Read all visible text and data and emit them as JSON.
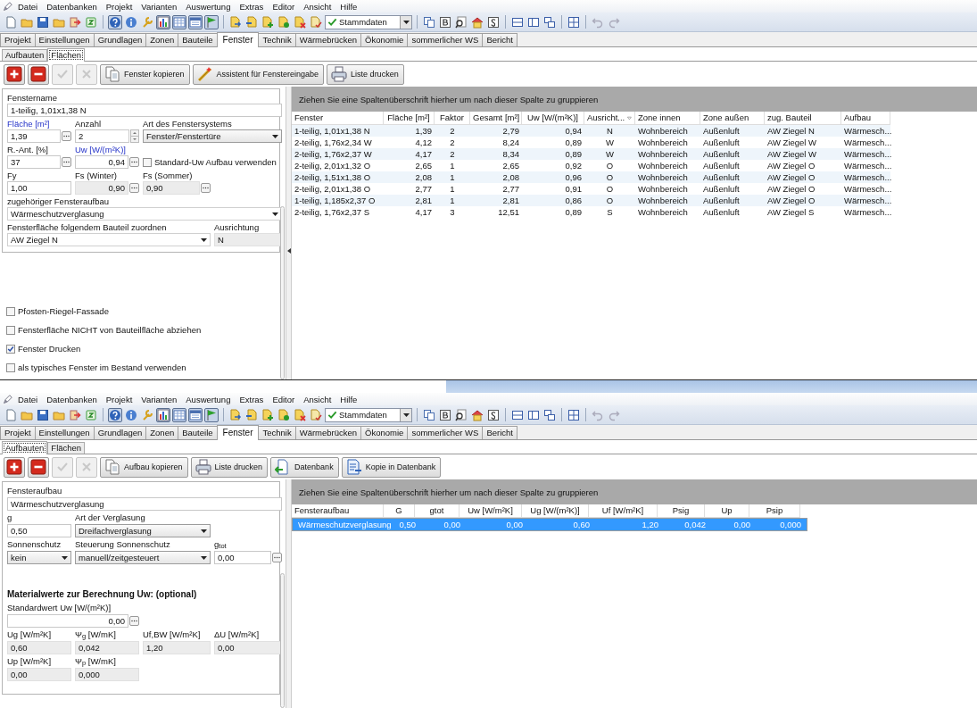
{
  "screens": [
    {
      "menu": [
        "Datei",
        "Datenbanken",
        "Projekt",
        "Varianten",
        "Auswertung",
        "Extras",
        "Editor",
        "Ansicht",
        "Hilfe"
      ],
      "dataset": "Stammdaten",
      "tabs": [
        {
          "label": "Projekt",
          "selected": false
        },
        {
          "label": "Einstellungen",
          "selected": false
        },
        {
          "label": "Grundlagen",
          "selected": false
        },
        {
          "label": "Zonen",
          "selected": false
        },
        {
          "label": "Bauteile",
          "selected": false
        },
        {
          "label": "Fenster",
          "selected": true
        },
        {
          "label": "Technik",
          "selected": false
        },
        {
          "label": "Wärmebrücken",
          "selected": false
        },
        {
          "label": "Ökonomie",
          "selected": false
        },
        {
          "label": "sommerlicher WS",
          "selected": false
        },
        {
          "label": "Bericht",
          "selected": false
        }
      ],
      "subtabs": [
        {
          "label": "Aufbauten",
          "selected": false
        },
        {
          "label": "Flächen",
          "selected": true
        }
      ],
      "actions": [
        {
          "kind": "add",
          "disabled": false
        },
        {
          "kind": "remove",
          "disabled": false
        },
        {
          "kind": "confirm",
          "disabled": true
        },
        {
          "kind": "cancel",
          "disabled": true
        },
        {
          "kind": "copy",
          "label": "Fenster kopieren",
          "disabled": false
        },
        {
          "kind": "wand",
          "label": "Assistent für Fenstereingabe",
          "disabled": false
        },
        {
          "kind": "print",
          "label": "Liste drucken",
          "disabled": false
        }
      ],
      "form": [
        [
          {
            "kind": "text_wide",
            "label": "Fenstername",
            "value": "1-teilig, 1,01x1,38 N",
            "link": false
          }
        ],
        [
          {
            "kind": "picker",
            "label": "Fläche [m²]",
            "value": "1,39",
            "link": true
          },
          {
            "kind": "spin",
            "label": "Anzahl",
            "value": "2",
            "link": false
          },
          {
            "kind": "select_wide",
            "label": "Art des Fenstersystems",
            "value": "Fenster/Fenstertüre",
            "link": false
          }
        ],
        [
          {
            "kind": "picker",
            "label": "R.-Ant. [%]",
            "value": "37",
            "link": false
          },
          {
            "kind": "picker_num",
            "label": "Uw [W/(m²K)]",
            "value": "0,94",
            "link": true
          },
          {
            "kind": "checkbox",
            "label": "Standard-Uw Aufbau verwenden",
            "checked": false
          }
        ],
        [
          {
            "kind": "text",
            "label": "Fy",
            "value": "1,00",
            "link": false
          },
          {
            "kind": "readonly_picker_num",
            "label": "Fs (Winter)",
            "value": "0,90",
            "link": false
          },
          {
            "kind": "readonly_picker",
            "label": "Fs (Sommer)",
            "value": "0,90",
            "link": false
          }
        ],
        [
          {
            "kind": "select_full",
            "label": "zugehöriger Fensteraufbau",
            "value": "Wärmeschutzverglasung",
            "link": false
          }
        ],
        [
          {
            "kind": "select_long",
            "label": "Fensterfläche folgendem Bauteil zuordnen",
            "value": "AW Ziegel N",
            "link": false
          },
          {
            "kind": "readonly",
            "label": "Ausrichtung",
            "value": "N",
            "link": false
          }
        ]
      ],
      "options": [
        {
          "label": "Pfosten-Riegel-Fassade",
          "checked": false
        },
        {
          "label": "Fensterfläche NICHT von Bauteilfläche abziehen",
          "checked": false
        },
        {
          "label": "Fenster Drucken",
          "checked": true
        },
        {
          "label": "als typisches Fenster im Bestand verwenden",
          "checked": false
        }
      ],
      "splitter_arrow": true,
      "grid": {
        "group_hint": "Ziehen Sie eine Spaltenüberschrift hierher um nach dieser Spalte zu gruppieren",
        "columns": [
          {
            "label": "Fenster",
            "kind": "text",
            "sorted": false
          },
          {
            "label": "Fläche [m²]",
            "kind": "number",
            "sorted": false
          },
          {
            "label": "Faktor",
            "kind": "center",
            "sorted": false
          },
          {
            "label": "Gesamt [m²]",
            "kind": "number",
            "sorted": false
          },
          {
            "label": "Uw [W/(m²K)]",
            "kind": "number",
            "sorted": false
          },
          {
            "label": "Ausricht...",
            "kind": "center",
            "sorted": true
          },
          {
            "label": "Zone innen",
            "kind": "text",
            "sorted": false
          },
          {
            "label": "Zone außen",
            "kind": "text",
            "sorted": false
          },
          {
            "label": "zug. Bauteil",
            "kind": "text",
            "sorted": false
          },
          {
            "label": "Aufbau",
            "kind": "text",
            "sorted": false
          }
        ],
        "rows": [
          {
            "selected": false,
            "cells": [
              "1-teilig, 1,01x1,38 N",
              "1,39",
              "2",
              "2,79",
              "0,94",
              "N",
              "Wohnbereich",
              "Außenluft",
              "AW Ziegel N",
              "Wärmesch..."
            ]
          },
          {
            "selected": false,
            "cells": [
              "2-teilig, 1,76x2,34 W",
              "4,12",
              "2",
              "8,24",
              "0,89",
              "W",
              "Wohnbereich",
              "Außenluft",
              "AW Ziegel W",
              "Wärmesch..."
            ]
          },
          {
            "selected": false,
            "cells": [
              "2-teilig, 1,76x2,37 W",
              "4,17",
              "2",
              "8,34",
              "0,89",
              "W",
              "Wohnbereich",
              "Außenluft",
              "AW Ziegel W",
              "Wärmesch..."
            ]
          },
          {
            "selected": false,
            "cells": [
              "2-teilig, 2,01x1,32 O",
              "2,65",
              "1",
              "2,65",
              "0,92",
              "O",
              "Wohnbereich",
              "Außenluft",
              "AW Ziegel O",
              "Wärmesch..."
            ]
          },
          {
            "selected": false,
            "cells": [
              "2-teilig, 1,51x1,38 O",
              "2,08",
              "1",
              "2,08",
              "0,96",
              "O",
              "Wohnbereich",
              "Außenluft",
              "AW Ziegel O",
              "Wärmesch..."
            ]
          },
          {
            "selected": false,
            "cells": [
              "2-teilig, 2,01x1,38 O",
              "2,77",
              "1",
              "2,77",
              "0,91",
              "O",
              "Wohnbereich",
              "Außenluft",
              "AW Ziegel O",
              "Wärmesch..."
            ]
          },
          {
            "selected": false,
            "cells": [
              "1-teilig, 1,185x2,37 O",
              "2,81",
              "1",
              "2,81",
              "0,86",
              "O",
              "Wohnbereich",
              "Außenluft",
              "AW Ziegel O",
              "Wärmesch..."
            ]
          },
          {
            "selected": false,
            "cells": [
              "2-teilig, 1,76x2,37 S",
              "4,17",
              "3",
              "12,51",
              "0,89",
              "S",
              "Wohnbereich",
              "Außenluft",
              "AW Ziegel S",
              "Wärmesch..."
            ]
          }
        ]
      }
    },
    {
      "menu": [
        "Datei",
        "Datenbanken",
        "Projekt",
        "Varianten",
        "Auswertung",
        "Extras",
        "Editor",
        "Ansicht",
        "Hilfe"
      ],
      "dataset": "Stammdaten",
      "tabs": [
        {
          "label": "Projekt",
          "selected": false
        },
        {
          "label": "Einstellungen",
          "selected": false
        },
        {
          "label": "Grundlagen",
          "selected": false
        },
        {
          "label": "Zonen",
          "selected": false
        },
        {
          "label": "Bauteile",
          "selected": false
        },
        {
          "label": "Fenster",
          "selected": true
        },
        {
          "label": "Technik",
          "selected": false
        },
        {
          "label": "Wärmebrücken",
          "selected": false
        },
        {
          "label": "Ökonomie",
          "selected": false
        },
        {
          "label": "sommerlicher WS",
          "selected": false
        },
        {
          "label": "Bericht",
          "selected": false
        }
      ],
      "subtabs": [
        {
          "label": "Aufbauten",
          "selected": true
        },
        {
          "label": "Flächen",
          "selected": false
        }
      ],
      "actions": [
        {
          "kind": "add",
          "disabled": false
        },
        {
          "kind": "remove",
          "disabled": false
        },
        {
          "kind": "confirm",
          "disabled": true
        },
        {
          "kind": "cancel",
          "disabled": true
        },
        {
          "kind": "copy",
          "label": "Aufbau kopieren",
          "disabled": false
        },
        {
          "kind": "print",
          "label": "Liste drucken",
          "disabled": false
        },
        {
          "kind": "database",
          "label": "Datenbank",
          "disabled": false
        },
        {
          "kind": "copy_db",
          "label": "Kopie in Datenbank",
          "disabled": false
        }
      ],
      "form": [
        [
          {
            "kind": "text_wide",
            "label": "Fensteraufbau",
            "value": "Wärmeschutzverglasung",
            "link": false
          }
        ],
        [
          {
            "kind": "text",
            "label": "g",
            "value": "0,50",
            "link": false
          },
          {
            "kind": "select_wide",
            "label": "Art der Verglasung",
            "value": "Dreifachverglasung",
            "link": false
          }
        ],
        [
          {
            "kind": "select",
            "label": "Sonnenschutz",
            "value": "kein",
            "link": false
          },
          {
            "kind": "select_wide",
            "label": "Steuerung Sonnenschutz",
            "value": "manuell/zeitgesteuert",
            "link": false
          },
          {
            "kind": "picker",
            "label": "g$_{tot}$",
            "value": "0,00",
            "link": false
          }
        ],
        [
          {
            "kind": "heading",
            "label": "Materialwerte zur Berechnung Uw: (optional)"
          }
        ],
        [
          {
            "kind": "picker_num_wide",
            "label": "Standardwert Uw [W/(m²K)]",
            "value": "0,00",
            "link": false
          }
        ],
        [
          {
            "kind": "readonly",
            "label": "Ug [W/m²K]",
            "value": "0,60",
            "link": false
          },
          {
            "kind": "readonly",
            "label": "Ψ$_{g}$ [W/mK]",
            "value": "0,042",
            "link": false
          },
          {
            "kind": "readonly",
            "label": "Uf,BW [W/m²K]",
            "value": "1,20",
            "link": false
          },
          {
            "kind": "readonly",
            "label": "ΔU [W/m²K]",
            "value": "0,00",
            "link": false
          }
        ],
        [
          {
            "kind": "readonly",
            "label": "Up [W/m²K]",
            "value": "0,00",
            "link": false
          },
          {
            "kind": "readonly",
            "label": "Ψ$_{p}$ [W/mK]",
            "value": "0,000",
            "link": false
          }
        ]
      ],
      "grid": {
        "group_hint": "Ziehen Sie eine Spaltenüberschrift hierher um nach dieser Spalte zu gruppieren",
        "columns": [
          {
            "label": "Fensteraufbau",
            "kind": "text",
            "sorted": false
          },
          {
            "label": "G",
            "kind": "number",
            "sorted": false
          },
          {
            "label": "gtot",
            "kind": "number",
            "sorted": false
          },
          {
            "label": "Uw [W/m²K]",
            "kind": "number",
            "sorted": false
          },
          {
            "label": "Ug [W/(m²K)]",
            "kind": "number",
            "sorted": false
          },
          {
            "label": "Uf [W/m²K]",
            "kind": "number",
            "sorted": false
          },
          {
            "label": "Psig",
            "kind": "number",
            "sorted": false
          },
          {
            "label": "Up",
            "kind": "number",
            "sorted": false
          },
          {
            "label": "Psip",
            "kind": "number",
            "sorted": false
          }
        ],
        "rows": [
          {
            "selected": true,
            "cells": [
              "Wärmeschutzverglasung",
              "0,50",
              "0,00",
              "0,00",
              "0,60",
              "1,20",
              "0,042",
              "0,00",
              "0,000"
            ]
          }
        ]
      }
    }
  ]
}
